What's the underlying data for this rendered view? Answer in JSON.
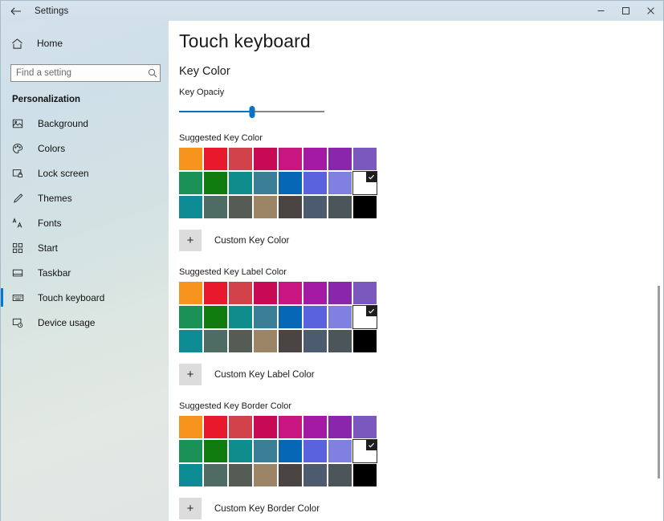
{
  "window": {
    "title": "Settings",
    "back_icon": "back-arrow-icon",
    "minimize_label": "Minimize",
    "maximize_label": "Maximize",
    "close_label": "Close"
  },
  "sidebar": {
    "home": {
      "label": "Home",
      "icon": "home-icon"
    },
    "search": {
      "placeholder": "Find a setting",
      "value": "",
      "icon": "search-icon"
    },
    "group_title": "Personalization",
    "items": [
      {
        "label": "Background",
        "icon": "image-icon",
        "selected": false
      },
      {
        "label": "Colors",
        "icon": "palette-icon",
        "selected": false
      },
      {
        "label": "Lock screen",
        "icon": "lock-screen-icon",
        "selected": false
      },
      {
        "label": "Themes",
        "icon": "brush-icon",
        "selected": false
      },
      {
        "label": "Fonts",
        "icon": "fonts-icon",
        "selected": false
      },
      {
        "label": "Start",
        "icon": "start-tiles-icon",
        "selected": false
      },
      {
        "label": "Taskbar",
        "icon": "taskbar-icon",
        "selected": false
      },
      {
        "label": "Touch keyboard",
        "icon": "keyboard-icon",
        "selected": true
      },
      {
        "label": "Device usage",
        "icon": "device-usage-icon",
        "selected": false
      }
    ],
    "accent_color": "#0078d4"
  },
  "main": {
    "page_title": "Touch keyboard",
    "section_title": "Key Color",
    "slider": {
      "label": "Key Opaciy",
      "value": 50,
      "min": 0,
      "max": 100,
      "fill_color": "#0a72c4",
      "track_color": "#868686"
    },
    "palette": [
      "#f7941d",
      "#e8192c",
      "#d2424a",
      "#c80a56",
      "#c9157f",
      "#a51aa5",
      "#8a26ac",
      "#7a58bd",
      "#1a9257",
      "#107c10",
      "#0f8c8c",
      "#3a7f96",
      "#0567b5",
      "#5b62dd",
      "#8080e0",
      "#ffffff",
      "#0d8c96",
      "#4e6b64",
      "#545c54",
      "#9c8566",
      "#4a4543",
      "#4d5b6e",
      "#4c5559",
      "#000000"
    ],
    "selected_index": 15,
    "selected_color": "#ffffff",
    "check_icon": "checkmark-icon",
    "sections": [
      {
        "grid_label": "Suggested Key Color",
        "custom_label": "Custom Key Color",
        "custom_icon": "plus-icon"
      },
      {
        "grid_label": "Suggested Key Label Color",
        "custom_label": "Custom Key Label Color",
        "custom_icon": "plus-icon"
      },
      {
        "grid_label": "Suggested Key Border Color",
        "custom_label": "Custom Key Border Color",
        "custom_icon": "plus-icon"
      }
    ]
  }
}
